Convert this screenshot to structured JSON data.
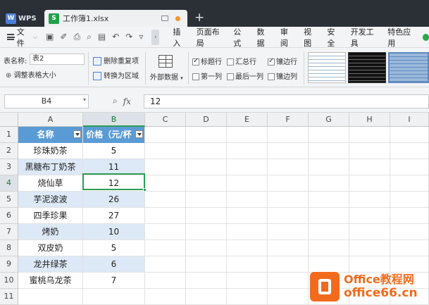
{
  "titlebar": {
    "app_tab": "WPS",
    "app_logo": "W",
    "doc_tab": "工作簿1.xlsx",
    "doc_logo": "S",
    "new_tab": "+"
  },
  "menubar": {
    "file": "文件",
    "tabs": [
      "插入",
      "页面布局",
      "公式",
      "数据",
      "审阅",
      "视图",
      "安全",
      "开发工具",
      "特色应用"
    ]
  },
  "ribbon": {
    "table_name_label": "表名称:",
    "table_name_value": "表2",
    "resize_table": "调整表格大小",
    "remove_duplicates": "删除重复项",
    "convert_to_range": "转换为区域",
    "external_data": "外部数据",
    "options": {
      "header_row": {
        "label": "标题行",
        "checked": true
      },
      "total_row": {
        "label": "汇总行",
        "checked": false
      },
      "banded_rows": {
        "label": "镶边行",
        "checked": true
      },
      "first_column": {
        "label": "第一列",
        "checked": false
      },
      "last_column": {
        "label": "最后一列",
        "checked": false
      },
      "banded_columns": {
        "label": "镶边列",
        "checked": false
      }
    }
  },
  "formula_bar": {
    "name_box": "B4",
    "fx_label": "fx",
    "value": "12"
  },
  "sheet": {
    "columns": [
      "A",
      "B",
      "C",
      "D",
      "E",
      "F",
      "G",
      "H",
      "I"
    ],
    "rows": [
      "1",
      "2",
      "3",
      "4",
      "5",
      "6",
      "7",
      "8",
      "9",
      "10",
      "11"
    ],
    "selected_cell": "B4",
    "table": {
      "headers": [
        "名称",
        "价格（元/杯"
      ],
      "rows": [
        [
          "珍珠奶茶",
          "5"
        ],
        [
          "黑糖布丁奶茶",
          "11"
        ],
        [
          "烧仙草",
          "12"
        ],
        [
          "芋泥波波",
          "26"
        ],
        [
          "四季珍果",
          "27"
        ],
        [
          "烤奶",
          "10"
        ],
        [
          "双皮奶",
          "5"
        ],
        [
          "龙井绿茶",
          "6"
        ],
        [
          "蜜桃乌龙茶",
          "7"
        ]
      ]
    },
    "colors": {
      "header": "#5b9bd5",
      "band": "#dde9f6",
      "selection": "#2f9d55"
    }
  },
  "watermark": {
    "line1": "Office教程网",
    "line2": "office66.cn"
  }
}
